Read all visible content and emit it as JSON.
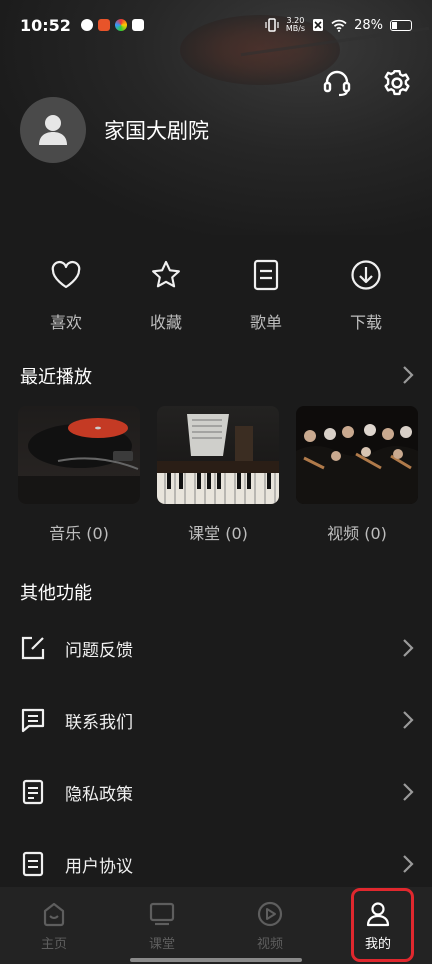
{
  "status_bar": {
    "time": "10:52",
    "net_speed_top": "3.20",
    "net_speed_bottom": "MB/s",
    "battery": "28%"
  },
  "profile": {
    "name": "家国大剧院"
  },
  "quick_actions": [
    {
      "label": "喜欢",
      "icon": "heart-icon"
    },
    {
      "label": "收藏",
      "icon": "star-icon"
    },
    {
      "label": "歌单",
      "icon": "playlist-icon"
    },
    {
      "label": "下载",
      "icon": "download-icon"
    }
  ],
  "recent": {
    "title": "最近播放",
    "items": [
      {
        "label": "音乐 (0)"
      },
      {
        "label": "课堂 (0)"
      },
      {
        "label": "视频 (0)"
      }
    ]
  },
  "other": {
    "title": "其他功能",
    "items": [
      {
        "label": "问题反馈",
        "icon": "feedback-icon"
      },
      {
        "label": "联系我们",
        "icon": "message-icon"
      },
      {
        "label": "隐私政策",
        "icon": "document-icon"
      },
      {
        "label": "用户协议",
        "icon": "agreement-icon"
      }
    ]
  },
  "tabbar": [
    {
      "label": "主页",
      "icon": "home-icon",
      "active": false
    },
    {
      "label": "课堂",
      "icon": "tv-icon",
      "active": false
    },
    {
      "label": "视频",
      "icon": "play-icon",
      "active": false
    },
    {
      "label": "我的",
      "icon": "person-icon",
      "active": true
    }
  ],
  "colors": {
    "background": "#1b1b1b",
    "tabbar": "#232323",
    "highlight": "#e0282e",
    "inactive_tab": "#5e5e5e"
  }
}
